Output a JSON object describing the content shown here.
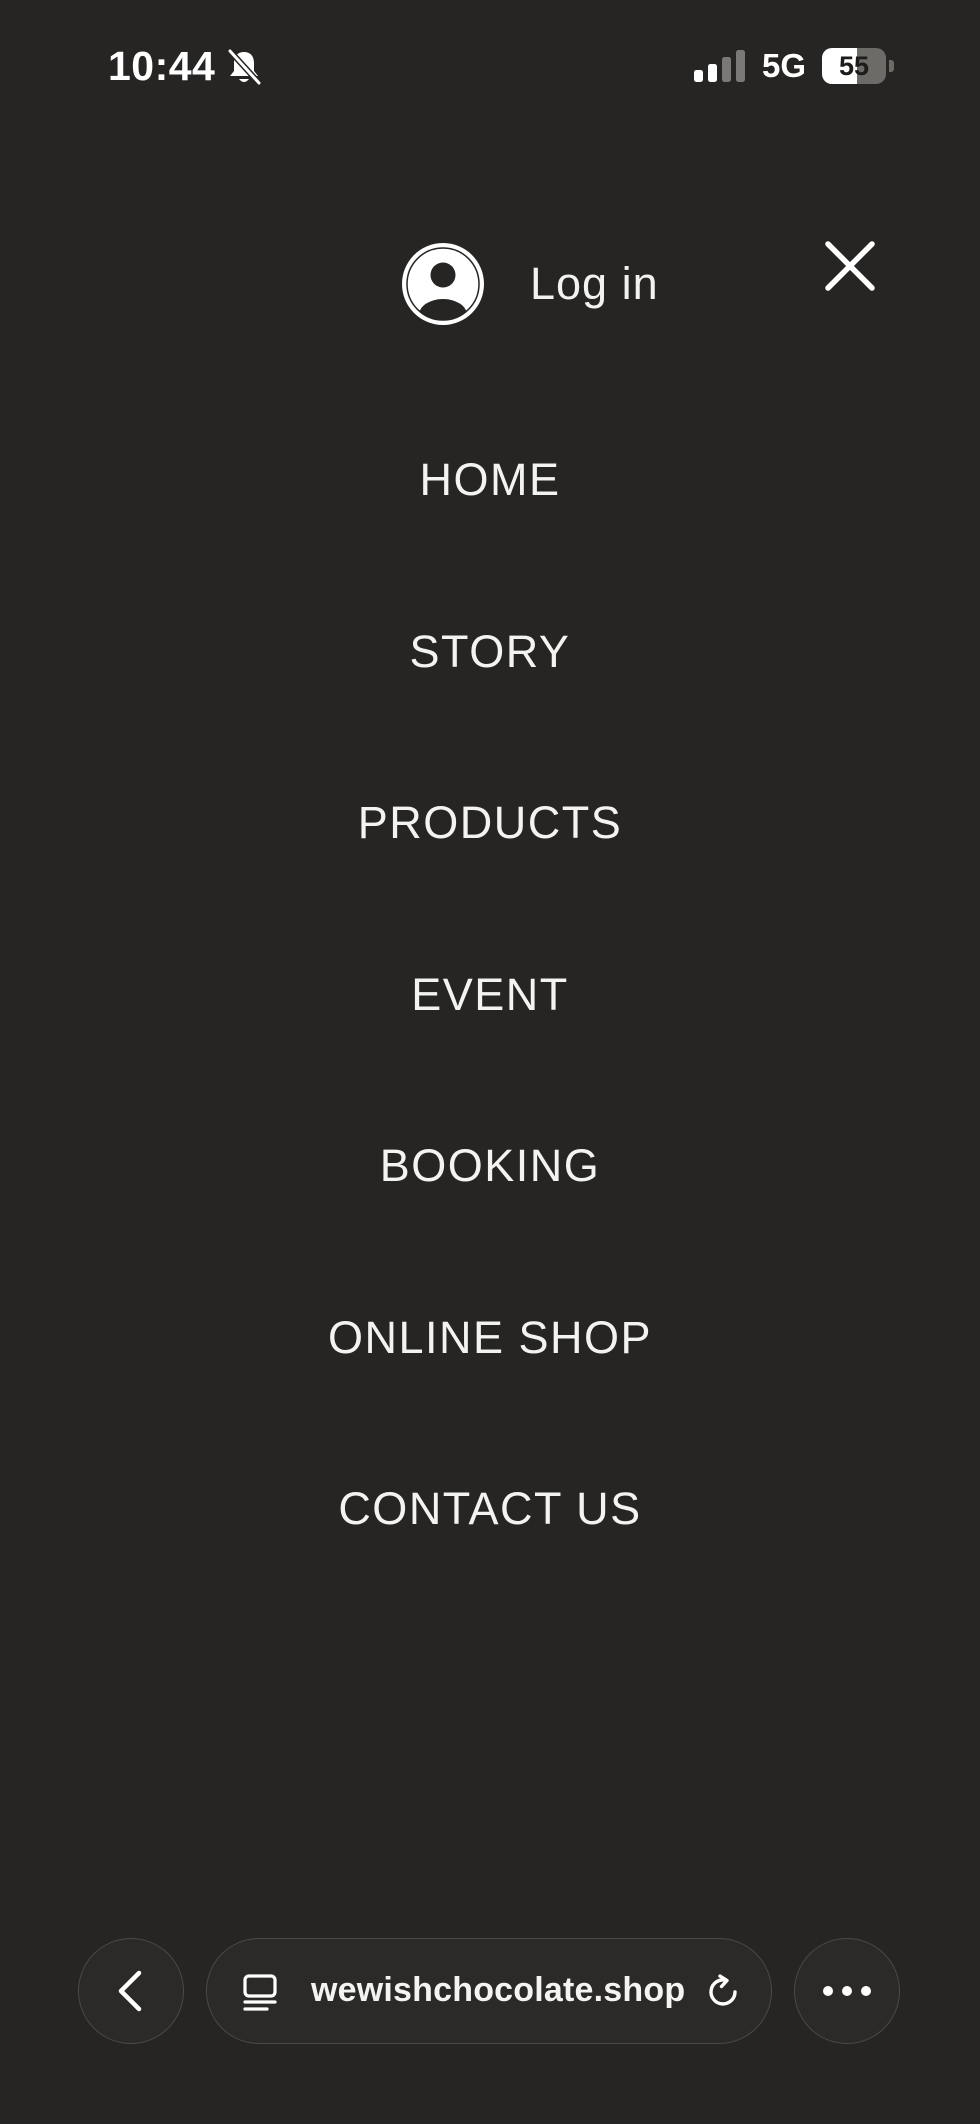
{
  "status_bar": {
    "time": "10:44",
    "network": "5G",
    "battery_level": "55",
    "battery_fraction": 0.55,
    "signal_bars_active": 2,
    "signal_bars_total": 4,
    "silent_mode_icon": "bell-slash-icon"
  },
  "menu": {
    "login_label": "Log in",
    "login_icon": "user-avatar-icon",
    "close_icon": "close-icon",
    "items": [
      {
        "label": "HOME"
      },
      {
        "label": "STORY"
      },
      {
        "label": "PRODUCTS"
      },
      {
        "label": "EVENT"
      },
      {
        "label": "BOOKING"
      },
      {
        "label": "ONLINE SHOP"
      },
      {
        "label": "CONTACT US"
      }
    ]
  },
  "browser": {
    "url": "wewishchocolate.shop",
    "back_icon": "chevron-left-icon",
    "tab_icon": "page-tabs-icon",
    "reload_icon": "reload-icon",
    "more_icon": "ellipsis-icon"
  },
  "colors": {
    "background": "#262523",
    "text": "#ffffff",
    "control_background": "#2b2a28",
    "control_border": "#4a4946"
  }
}
